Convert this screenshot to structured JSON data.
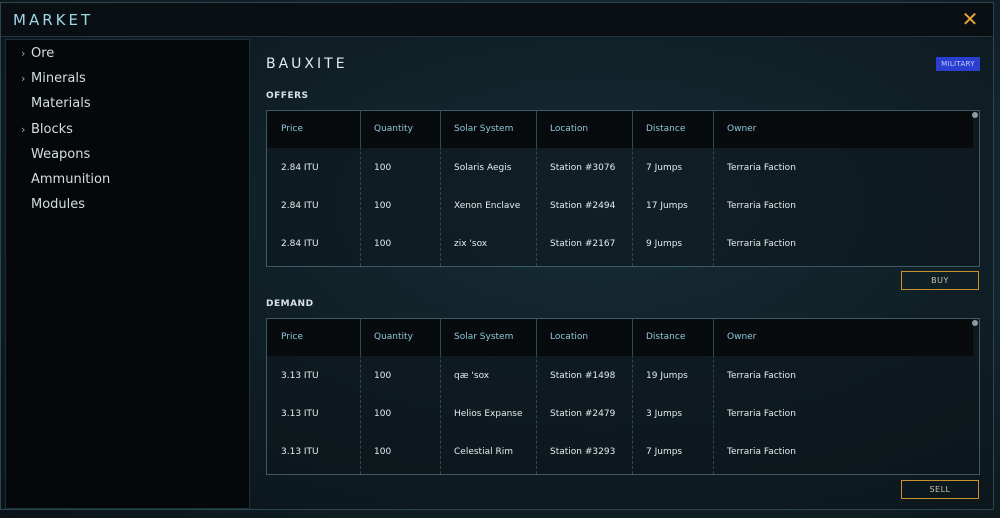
{
  "window": {
    "title": "MARKET",
    "close_icon": "close-icon"
  },
  "sidebar": {
    "items": [
      {
        "label": "Ore",
        "has_arrow": true
      },
      {
        "label": "Minerals",
        "has_arrow": true
      },
      {
        "label": "Materials",
        "has_arrow": false
      },
      {
        "label": "Blocks",
        "has_arrow": true
      },
      {
        "label": "Weapons",
        "has_arrow": false
      },
      {
        "label": "Ammunition",
        "has_arrow": false
      },
      {
        "label": "Modules",
        "has_arrow": false
      }
    ],
    "arrow_glyph": "›"
  },
  "item": {
    "name": "BAUXITE",
    "badge": "MILITARY"
  },
  "columns": [
    "Price",
    "Quantity",
    "Solar System",
    "Location",
    "Distance",
    "Owner"
  ],
  "offers": {
    "label": "OFFERS",
    "rows": [
      [
        "2.84 ITU",
        "100",
        "Solaris Aegis",
        "Station #3076",
        "7 Jumps",
        "Terraria Faction"
      ],
      [
        "2.84 ITU",
        "100",
        "Xenon Enclave",
        "Station #2494",
        "17 Jumps",
        "Terraria Faction"
      ],
      [
        "2.84 ITU",
        "100",
        "zix 'sox",
        "Station #2167",
        "9 Jumps",
        "Terraria Faction"
      ]
    ],
    "action_label": "BUY"
  },
  "demand": {
    "label": "DEMAND",
    "rows": [
      [
        "3.13 ITU",
        "100",
        "qæ 'sox",
        "Station #1498",
        "19 Jumps",
        "Terraria Faction"
      ],
      [
        "3.13 ITU",
        "100",
        "Helios Expanse",
        "Station #2479",
        "3 Jumps",
        "Terraria Faction"
      ],
      [
        "3.13 ITU",
        "100",
        "Celestial Rim",
        "Station #3293",
        "7 Jumps",
        "Terraria Faction"
      ]
    ],
    "action_label": "SELL"
  },
  "colors": {
    "accent": "#e8a43a",
    "header_text": "#8ec8da",
    "badge_bg": "#2a3fd0"
  }
}
